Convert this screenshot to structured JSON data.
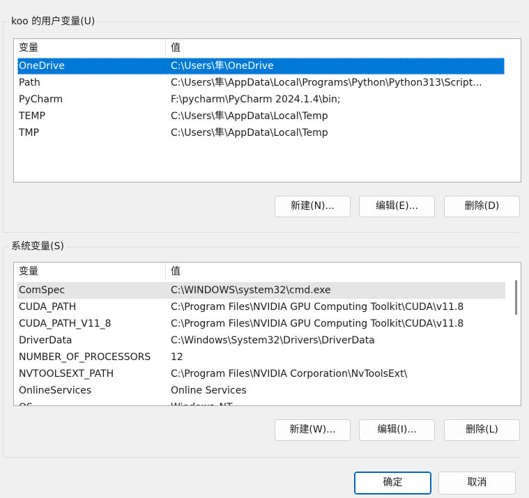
{
  "user_vars": {
    "title": "koo 的用户变量(U)",
    "columns": {
      "name": "变量",
      "value": "值"
    },
    "rows": [
      {
        "name": "OneDrive",
        "value": "C:\\Users\\隼\\OneDrive",
        "selected": true
      },
      {
        "name": "Path",
        "value": "C:\\Users\\隼\\AppData\\Local\\Programs\\Python\\Python313\\Script..."
      },
      {
        "name": "PyCharm",
        "value": "F:\\pycharm\\PyCharm 2024.1.4\\bin;"
      },
      {
        "name": "TEMP",
        "value": "C:\\Users\\隼\\AppData\\Local\\Temp"
      },
      {
        "name": "TMP",
        "value": "C:\\Users\\隼\\AppData\\Local\\Temp"
      }
    ],
    "buttons": {
      "new": "新建(N)...",
      "edit": "编辑(E)...",
      "delete": "删除(D)"
    }
  },
  "system_vars": {
    "title": "系统变量(S)",
    "columns": {
      "name": "变量",
      "value": "值"
    },
    "rows": [
      {
        "name": "ComSpec",
        "value": "C:\\WINDOWS\\system32\\cmd.exe",
        "hover": true
      },
      {
        "name": "CUDA_PATH",
        "value": "C:\\Program Files\\NVIDIA GPU Computing Toolkit\\CUDA\\v11.8"
      },
      {
        "name": "CUDA_PATH_V11_8",
        "value": "C:\\Program Files\\NVIDIA GPU Computing Toolkit\\CUDA\\v11.8"
      },
      {
        "name": "DriverData",
        "value": "C:\\Windows\\System32\\Drivers\\DriverData"
      },
      {
        "name": "NUMBER_OF_PROCESSORS",
        "value": "12"
      },
      {
        "name": "NVTOOLSEXT_PATH",
        "value": "C:\\Program Files\\NVIDIA Corporation\\NvToolsExt\\"
      },
      {
        "name": "OnlineServices",
        "value": "Online Services"
      },
      {
        "name": "OS",
        "value": "Windows_NT"
      }
    ],
    "buttons": {
      "new": "新建(W)...",
      "edit": "编辑(I)...",
      "delete": "删除(L)"
    }
  },
  "dialog_buttons": {
    "ok": "确定",
    "cancel": "取消"
  },
  "colors": {
    "selection": "#0078d7",
    "hover_row": "#e5e5e5",
    "focus_border": "#0067c0"
  }
}
